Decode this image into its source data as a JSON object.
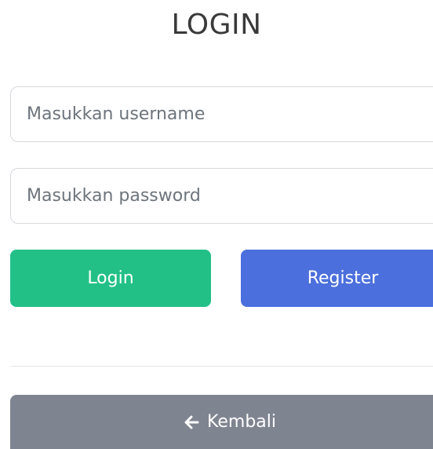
{
  "page": {
    "title": "LOGIN"
  },
  "form": {
    "username": {
      "value": "",
      "placeholder": "Masukkan username"
    },
    "password": {
      "value": "",
      "placeholder": "Masukkan password"
    }
  },
  "buttons": {
    "login_label": "Login",
    "register_label": "Register",
    "back_label": "Kembali",
    "back_icon": "arrow-left-icon"
  },
  "colors": {
    "login": "#22c087",
    "register": "#4b6fdc",
    "back": "#7f8491",
    "input_border": "#d6d9de"
  }
}
